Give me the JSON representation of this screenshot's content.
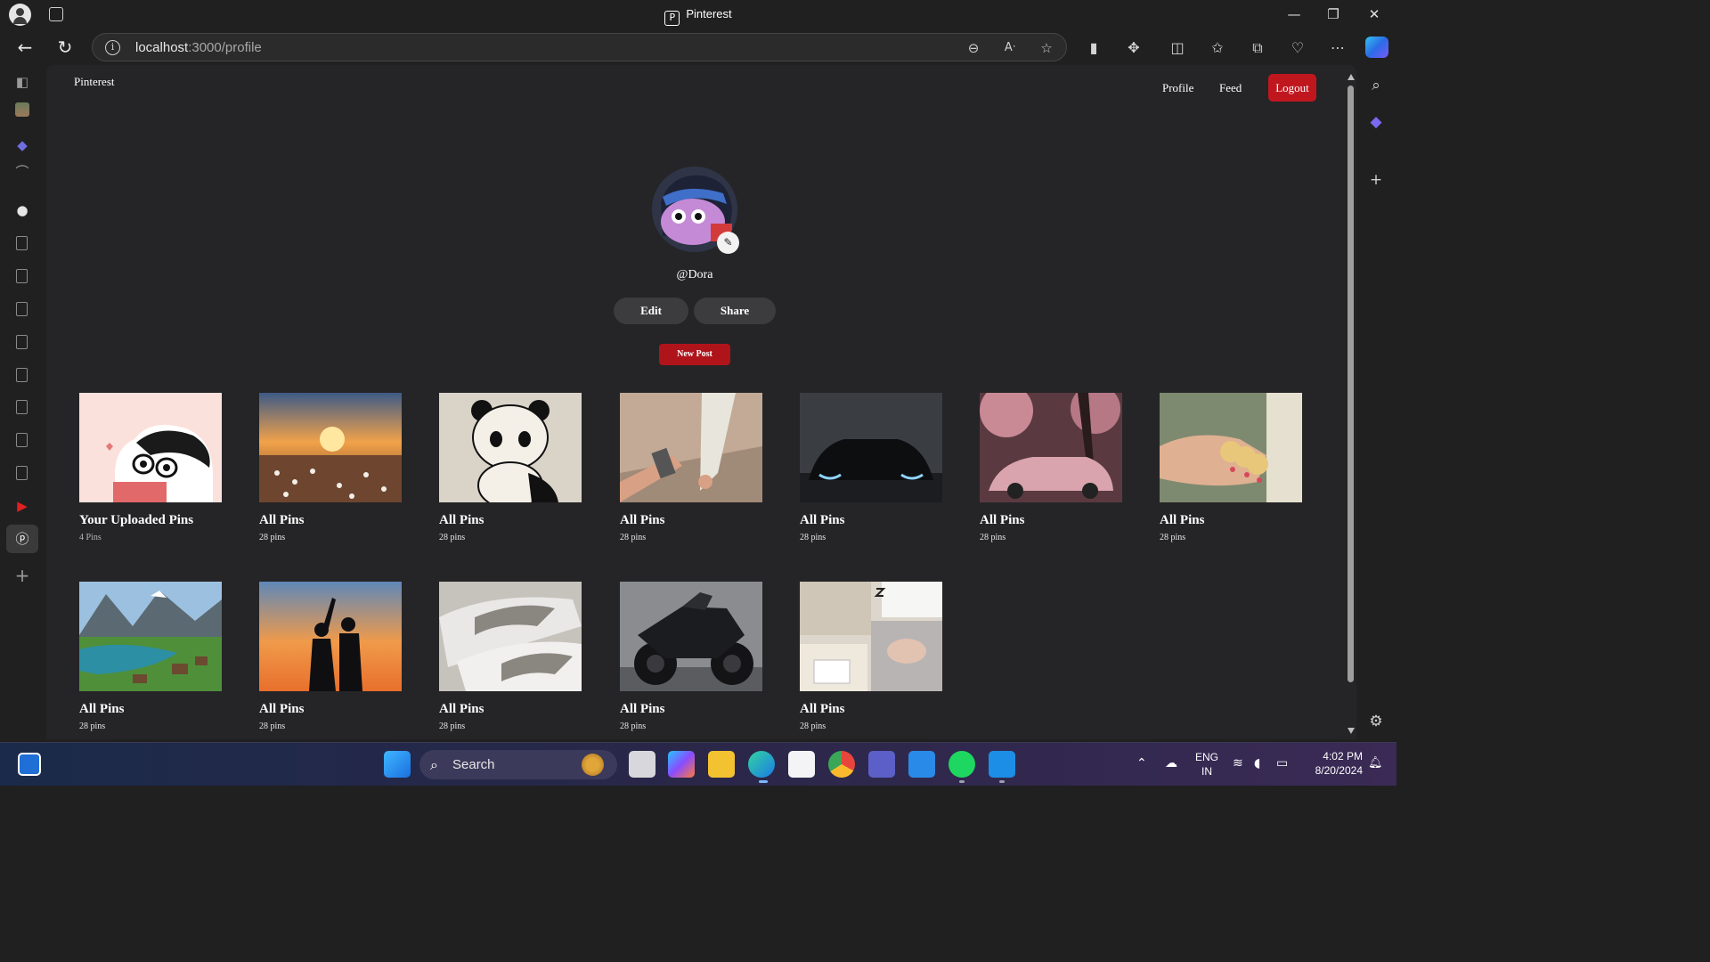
{
  "browser": {
    "window_title": "Pinterest",
    "url_host": "localhost",
    "url_path": ":3000/profile"
  },
  "site": {
    "brand": "Pinterest",
    "nav": {
      "profile": "Profile",
      "feed": "Feed",
      "logout": "Logout"
    }
  },
  "profile": {
    "username": "@Dora",
    "edit_label": "Edit",
    "share_label": "Share",
    "new_post_label": "New Post"
  },
  "boards": [
    {
      "name": "Your Uploaded Pins",
      "count": "4 Pins",
      "image": "cartoon-boy-pink"
    },
    {
      "name": "All Pins",
      "count": "28 pins",
      "image": "sunset-flower-field"
    },
    {
      "name": "All Pins",
      "count": "28 pins",
      "image": "panda-sketch"
    },
    {
      "name": "All Pins",
      "count": "28 pins",
      "image": "holding-hands"
    },
    {
      "name": "All Pins",
      "count": "28 pins",
      "image": "black-car"
    },
    {
      "name": "All Pins",
      "count": "28 pins",
      "image": "pink-car-blossoms"
    },
    {
      "name": "All Pins",
      "count": "28 pins",
      "image": "bangles-in-hand"
    },
    {
      "name": "All Pins",
      "count": "28 pins",
      "image": "mountain-lake-village"
    },
    {
      "name": "All Pins",
      "count": "28 pins",
      "image": "dancing-couple-silhouette"
    },
    {
      "name": "All Pins",
      "count": "28 pins",
      "image": "sneakers"
    },
    {
      "name": "All Pins",
      "count": "28 pins",
      "image": "black-motorcycle"
    },
    {
      "name": "All Pins",
      "count": "28 pins",
      "image": "sleep-collage"
    }
  ],
  "taskbar": {
    "search_placeholder": "Search",
    "language": "ENG",
    "region": "IN",
    "time": "4:02 PM",
    "date": "8/20/2024"
  },
  "colors": {
    "logout_bg": "#c0171f",
    "new_post_bg": "#b0141b",
    "page_bg": "#252527",
    "pill_bg": "#3c3c3e"
  }
}
